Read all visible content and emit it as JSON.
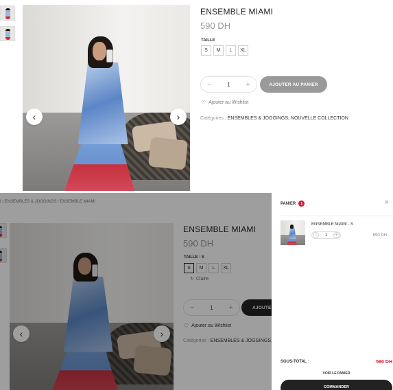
{
  "product": {
    "title": "ENSEMBLE MIAMI",
    "price": "590 DH",
    "size_label": "TAILLE",
    "sizes": [
      "S",
      "M",
      "L",
      "XL"
    ],
    "quantity": "1",
    "add_to_cart": "AJOUTER AU PANIER",
    "wishlist": "Ajouter au Wishlist",
    "categories_label": "Catégories :",
    "categories": "ENSEMBLES & JOGGINGS, NOUVELLE COLLECTION"
  },
  "lower": {
    "breadcrumb": "I / ENSEMBLES & JOGGINGS / ENSEMBLE MIAMI",
    "size_label": "TAILLE : S",
    "selected_size": "S",
    "clear": "Claire",
    "add_to_cart_partial": "AJOUTER",
    "categories_partial": "ENSEMBLES & JOGGINGS, N"
  },
  "cart": {
    "title": "PANIER",
    "count": "1",
    "item_name": "ENSEMBLE MIAMI - S",
    "item_qty": "1",
    "item_price": "590 DH",
    "subtotal_label": "SOUS-TOTAL :",
    "subtotal": "590 DH",
    "view_cart": "VOIR LE PANIER",
    "checkout": "COMMANDER"
  },
  "icons": {
    "prev": "chevron-left-icon",
    "next": "chevron-right-icon",
    "wishlist": "heart-icon",
    "close": "close-icon",
    "clear": "refresh-icon"
  },
  "colors": {
    "accent": "#d31a2b",
    "button_grey": "#9a9a9a",
    "checkout_dark": "#222222"
  }
}
